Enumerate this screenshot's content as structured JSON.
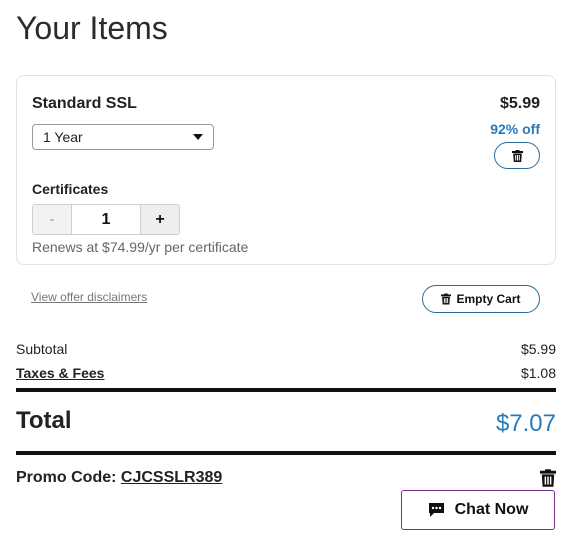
{
  "page": {
    "title": "Your Items"
  },
  "item": {
    "name": "Standard SSL",
    "price": "$5.99",
    "discount": "92% off",
    "term_selected": "1 Year",
    "certificates_label": "Certificates",
    "quantity": "1",
    "minus_label": "-",
    "plus_label": "+",
    "renews": "Renews at $74.99/yr per certificate"
  },
  "actions": {
    "disclaimers": "View offer disclaimers",
    "empty_cart": "Empty Cart"
  },
  "summary": {
    "subtotal_label": "Subtotal",
    "subtotal_value": "$5.99",
    "taxes_label": "Taxes & Fees",
    "taxes_value": "$1.08",
    "total_label": "Total",
    "total_value": "$7.07"
  },
  "promo": {
    "label": "Promo Code:",
    "code": "CJCSSLR389"
  },
  "chat": {
    "label": "Chat Now",
    "icon": "chat-bubble-icon"
  },
  "colors": {
    "accent_blue": "#2a7ab8",
    "button_border": "#2a6c95",
    "chat_border": "#7b2d8c"
  }
}
